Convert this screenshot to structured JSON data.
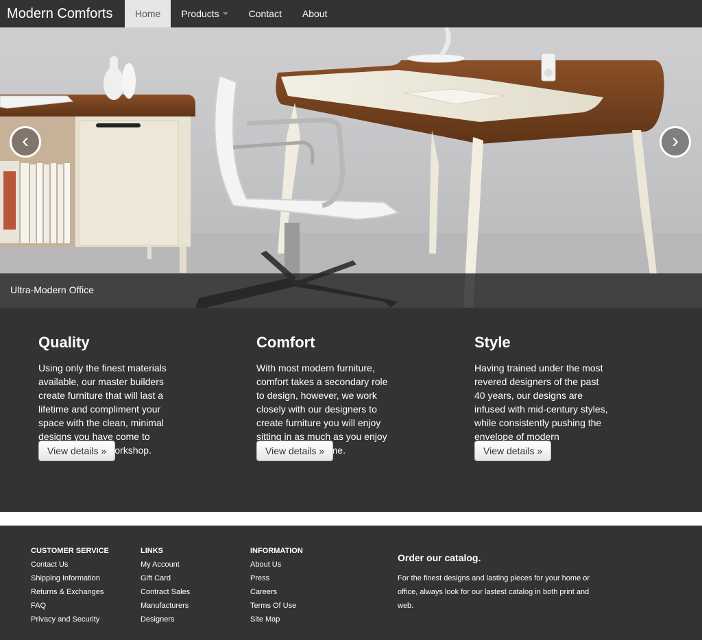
{
  "navbar": {
    "brand": "Modern Comforts",
    "items": [
      {
        "label": "Home",
        "active": true
      },
      {
        "label": "Products",
        "dropdown": true
      },
      {
        "label": "Contact"
      },
      {
        "label": "About"
      }
    ]
  },
  "carousel": {
    "prev_icon": "‹",
    "next_icon": "›",
    "caption": "Ultra-Modern Office"
  },
  "features": [
    {
      "title": "Quality",
      "text": "Using only the finest materials\navailable, our master builders\ncreate furniture that will last a\nlifetime and compliment your\nspace with the clean, minimal\ndesigns you have come to\nexpect from our workshop.",
      "button": "View details »"
    },
    {
      "title": "Comfort",
      "text": "With most modern furniture,\ncomfort takes a secondary role\nto design, however, we work\nclosely with our designers to\ncreate furniture you will enjoy\nsitting in as much as you enjoy\nhaving in your home.",
      "button": "View details »"
    },
    {
      "title": "Style",
      "text": "Having trained under the most\nrevered designers of the past\n40 years, our designs are\ninfused with mid-century styles,\nwhile consistently pushing the\nenvelope of modern\nminimalism.",
      "button": "View details »"
    }
  ],
  "footer": {
    "columns": [
      {
        "heading": "CUSTOMER SERVICE",
        "links": [
          "Contact Us",
          "Shipping Information",
          "Returns & Exchanges",
          "FAQ",
          "Privacy and Security"
        ]
      },
      {
        "heading": "LINKS",
        "links": [
          "My Account",
          "Gift Card",
          "Contract Sales",
          "Manufacturers",
          "Designers"
        ]
      },
      {
        "heading": "INFORMATION",
        "links": [
          "About Us",
          "Press",
          "Careers",
          "Terms Of Use",
          "Site Map"
        ]
      }
    ],
    "catalog": {
      "title": "Order our catalog.",
      "text": "For the finest designs and lasting pieces for your home or\noffice, always look for our lastest catalog in both print and\nweb."
    }
  },
  "colors": {
    "dark": "#333333",
    "active_nav": "#e6e6e6",
    "walnut": "#7a4522"
  }
}
